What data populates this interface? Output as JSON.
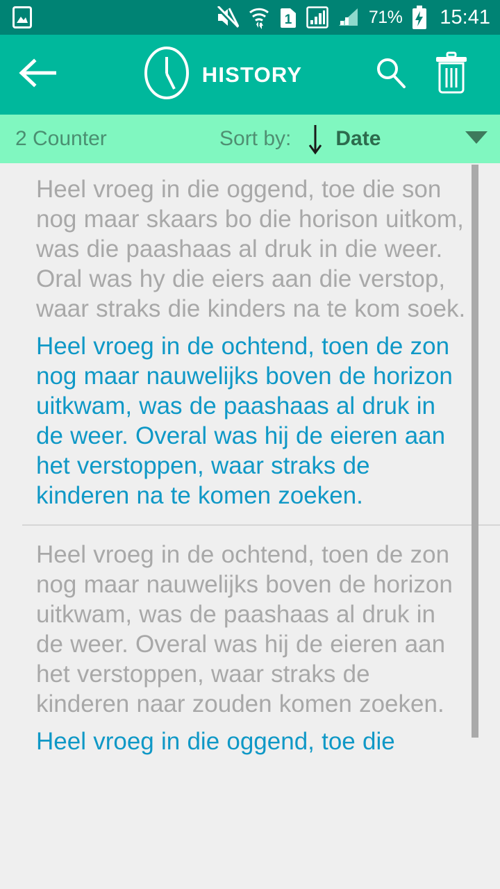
{
  "status_bar": {
    "icons": [
      "image-placeholder-icon",
      "mute-icon",
      "wifi-icon",
      "sim1-icon",
      "signal-icon",
      "signal-secondary-icon"
    ],
    "battery_percent": "71%",
    "battery_icon": "battery-charging-icon",
    "time": "15:41",
    "bg_color": "#008374"
  },
  "app_bar": {
    "back_icon": "back-arrow-icon",
    "clock_icon": "clock-icon",
    "title": "HISTORY",
    "search_icon": "search-icon",
    "delete_icon": "trash-icon",
    "bg_color": "#00b89c"
  },
  "sort_bar": {
    "counter": "2 Counter",
    "sort_by_label": "Sort by:",
    "sort_direction_icon": "arrow-down-icon",
    "sort_value": "Date",
    "caret_icon": "chevron-down-icon",
    "bg_color": "#80f7c0"
  },
  "history": {
    "source_color": "#a8a8a8",
    "target_color": "#0f98c6",
    "items": [
      {
        "source_text": "Heel vroeg in die oggend, toe die son nog maar skaars bo die horison uitkom, was die paashaas al druk in die weer. Oral was hy die eiers aan die verstop, waar straks die kinders na te kom soek.",
        "target_text": "Heel vroeg in de ochtend, toen de zon nog maar nauwelijks boven de horizon uitkwam, was de paashaas al druk in de weer. Overal was hij de eieren aan het verstoppen, waar straks de kinderen na te komen zoeken."
      },
      {
        "source_text": "Heel vroeg in de ochtend, toen de zon nog maar nauwelijks boven de horizon uitkwam, was de paashaas al druk in de weer. Overal was hij de eieren aan het verstoppen, waar straks de kinderen naar zouden komen zoeken.",
        "target_text": "Heel vroeg in die oggend, toe die"
      }
    ]
  }
}
